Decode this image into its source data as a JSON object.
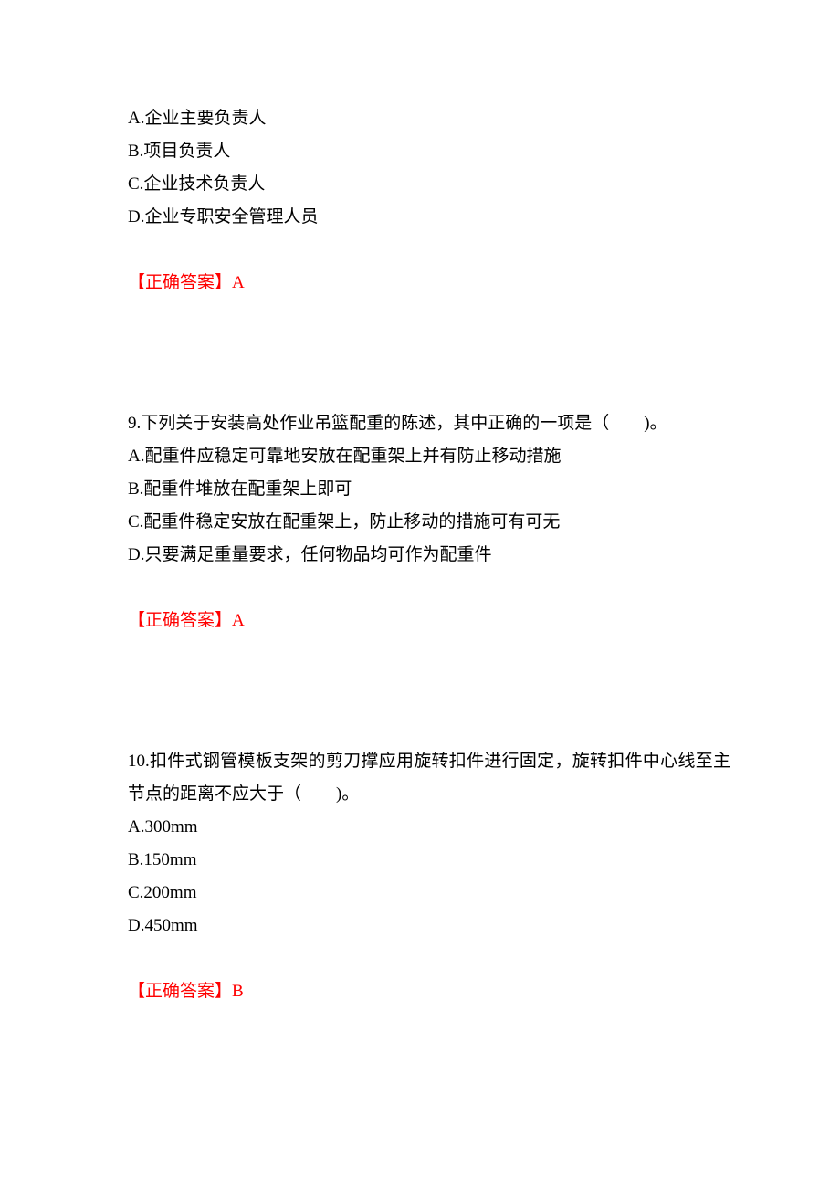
{
  "q8": {
    "options": {
      "A": "A.企业主要负责人",
      "B": "B.项目负责人",
      "C": "C.企业技术负责人",
      "D": "D.企业专职安全管理人员"
    },
    "answer": "【正确答案】A"
  },
  "q9": {
    "stem": "9.下列关于安装高处作业吊篮配重的陈述，其中正确的一项是（　　)。",
    "options": {
      "A": "A.配重件应稳定可靠地安放在配重架上并有防止移动措施",
      "B": "B.配重件堆放在配重架上即可",
      "C": "C.配重件稳定安放在配重架上，防止移动的措施可有可无",
      "D": "D.只要满足重量要求，任何物品均可作为配重件"
    },
    "answer": "【正确答案】A"
  },
  "q10": {
    "stem": "10.扣件式钢管模板支架的剪刀撑应用旋转扣件进行固定，旋转扣件中心线至主节点的距离不应大于（　　)。",
    "options": {
      "A": "A.300mm",
      "B": "B.150mm",
      "C": "C.200mm",
      "D": "D.450mm"
    },
    "answer": "【正确答案】B"
  }
}
